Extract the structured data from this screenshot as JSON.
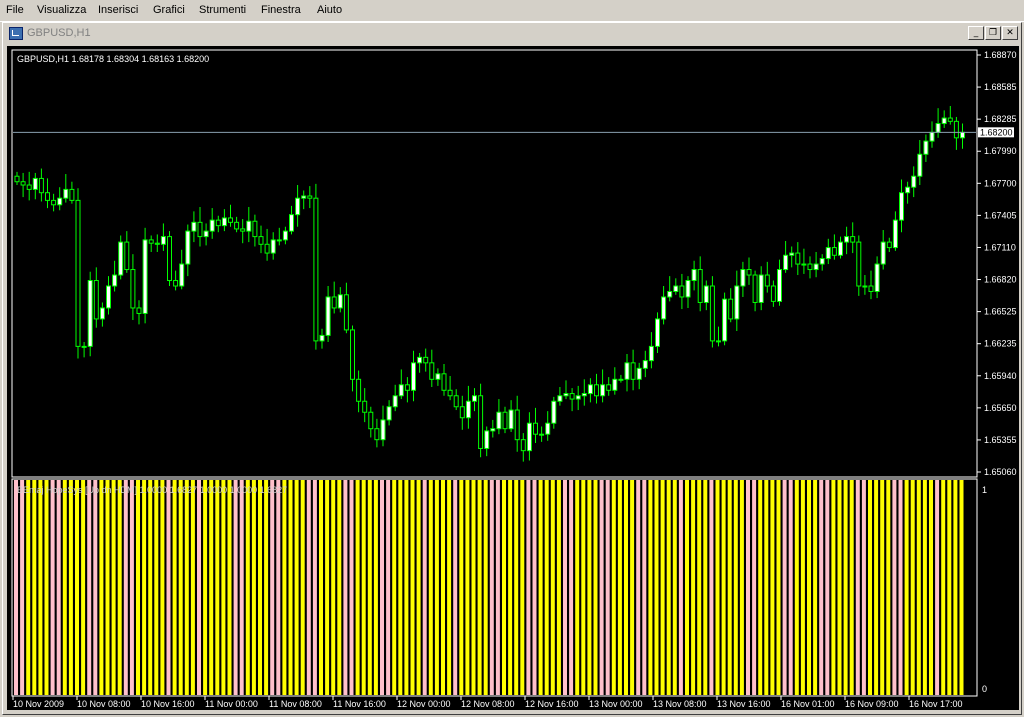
{
  "menu": [
    "File",
    "Visualizza",
    "Inserisci",
    "Grafici",
    "Strumenti",
    "Finestra",
    "Aiuto"
  ],
  "window": {
    "title": "GBPUSD,H1",
    "buttons": {
      "minimize": "_",
      "restore": "❐",
      "close": "✕"
    }
  },
  "chart": {
    "info_line": "GBPUSD,H1  1.68178 1.68304 1.68163 1.68200",
    "indicator_line": "BEmaj  HopeSys [Up dn HDM] 1.0000 1.6827 1.0000 1.0000 1.6827",
    "current_price": "1.68200",
    "price_ticks": [
      "1.68870",
      "1.68585",
      "1.68285",
      "1.67990",
      "1.67700",
      "1.67405",
      "1.67110",
      "1.66820",
      "1.66525",
      "1.66235",
      "1.65940",
      "1.65650",
      "1.65355",
      "1.65060"
    ],
    "indicator_ticks": [
      "1",
      "0"
    ],
    "time_labels": [
      "10 Nov 2009",
      "10 Nov 08:00",
      "10 Nov 16:00",
      "11 Nov 00:00",
      "11 Nov 08:00",
      "11 Nov 16:00",
      "12 Nov 00:00",
      "12 Nov 08:00",
      "12 Nov 16:00",
      "13 Nov 00:00",
      "13 Nov 08:00",
      "13 Nov 16:00",
      "16 Nov 01:00",
      "16 Nov 09:00",
      "16 Nov 17:00"
    ],
    "colors": {
      "background": "#000000",
      "foreground": "#ffffff",
      "candle_up_body": "#ffffff",
      "candle_down_body": "#000000",
      "candle_outline": "#00ff00",
      "bid_line": "#8aa0b0",
      "hist_up": "#ffff00",
      "hist_down": "#ffc0cb"
    }
  },
  "chart_data": {
    "type": "candlestick",
    "symbol": "GBPUSD",
    "timeframe": "H1",
    "ylim": [
      1.6506,
      1.6895
    ],
    "close": [
      1.6775,
      1.6772,
      1.6768,
      1.6778,
      1.6765,
      1.6758,
      1.6754,
      1.676,
      1.6768,
      1.6758,
      1.6625,
      1.6625,
      1.6685,
      1.665,
      1.666,
      1.668,
      1.669,
      1.672,
      1.6695,
      1.666,
      1.6655,
      1.6722,
      1.6719,
      1.6718,
      1.6725,
      1.6685,
      1.668,
      1.67,
      1.673,
      1.6738,
      1.6725,
      1.673,
      1.674,
      1.6735,
      1.6742,
      1.6738,
      1.6732,
      1.673,
      1.6739,
      1.6725,
      1.6718,
      1.671,
      1.6722,
      1.6722,
      1.673,
      1.6745,
      1.676,
      1.6762,
      1.676,
      1.663,
      1.6635,
      1.667,
      1.666,
      1.6672,
      1.664,
      1.6595,
      1.6575,
      1.6565,
      1.655,
      1.654,
      1.6558,
      1.657,
      1.658,
      1.659,
      1.6585,
      1.661,
      1.6615,
      1.661,
      1.6595,
      1.66,
      1.6585,
      1.658,
      1.657,
      1.656,
      1.6575,
      1.658,
      1.6532,
      1.6548,
      1.655,
      1.6565,
      1.655,
      1.6567,
      1.654,
      1.653,
      1.6555,
      1.6545,
      1.6545,
      1.6555,
      1.6575,
      1.658,
      1.6582,
      1.6577,
      1.658,
      1.6582,
      1.659,
      1.658,
      1.659,
      1.6585,
      1.6595,
      1.6595,
      1.661,
      1.6595,
      1.6605,
      1.6612,
      1.6625,
      1.665,
      1.667,
      1.6675,
      1.668,
      1.667,
      1.6685,
      1.6695,
      1.6665,
      1.668,
      1.663,
      1.663,
      1.6668,
      1.665,
      1.668,
      1.6695,
      1.669,
      1.6665,
      1.669,
      1.668,
      1.6666,
      1.6695,
      1.6708,
      1.671,
      1.67,
      1.67,
      1.6695,
      1.67,
      1.6705,
      1.6715,
      1.6708,
      1.672,
      1.6725,
      1.672,
      1.668,
      1.668,
      1.6675,
      1.67,
      1.672,
      1.6715,
      1.674,
      1.6765,
      1.677,
      1.678,
      1.68,
      1.6812,
      1.682,
      1.6828,
      1.6833,
      1.683,
      1.6815,
      1.682
    ],
    "histogram": "alternating binary state bars (1 = yellow, 0 = pink) across all bars",
    "hist_ylim": [
      0,
      1
    ]
  }
}
